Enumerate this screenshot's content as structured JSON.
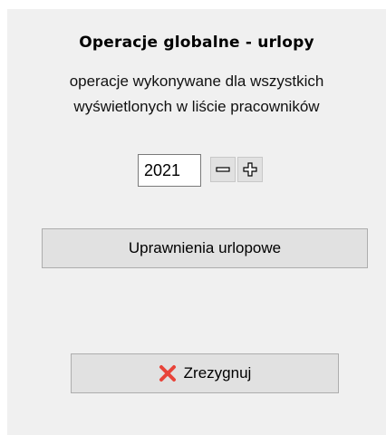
{
  "dialog": {
    "title": "Operacje globalne - urlopy",
    "subtitle_line1": "operacje wykonywane dla wszystkich",
    "subtitle_line2": "wyświetlonych w liście pracowników"
  },
  "year": {
    "value": "2021",
    "decrement_icon": "minus-icon",
    "increment_icon": "plus-icon"
  },
  "buttons": {
    "entitlements_label": "Uprawnienia urlopowe",
    "cancel_label": "Zrezygnuj",
    "cancel_icon": "cross-icon",
    "cancel_icon_color": "#e8443a"
  }
}
